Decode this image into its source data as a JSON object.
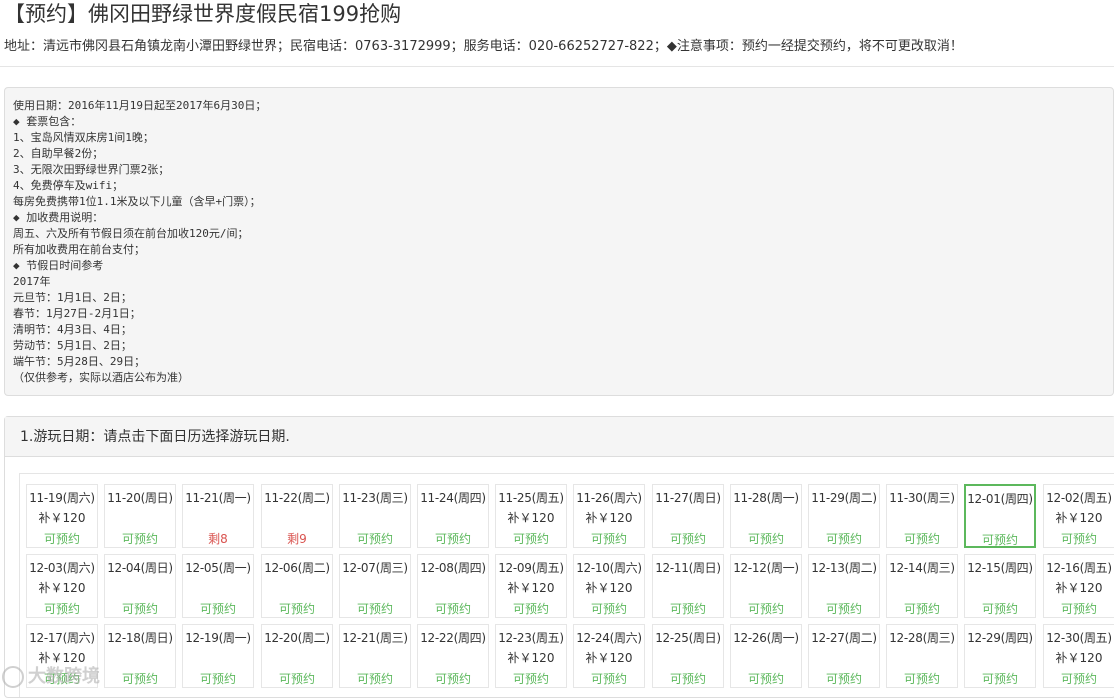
{
  "page": {
    "title": "【预约】佛冈田野绿世界度假民宿199抢购",
    "address_line": "地址：清远市佛冈县石角镇龙南小潭田野绿世界；民宿电话：0763-3172999；服务电话：020-66252727-822；◆注意事项：预约一经提交预约，将不可更改取消！"
  },
  "info": {
    "lines": [
      "使用日期：2016年11月19日起至2017年6月30日；",
      "◆ 套票包含：",
      "1、宝岛风情双床房1间1晚；",
      "2、自助早餐2份；",
      "3、无限次田野绿世界门票2张；",
      "4、免费停车及wifi；",
      "每房免费携带1位1.1米及以下儿童（含早+门票）；",
      "◆ 加收费用说明：",
      "周五、六及所有节假日须在前台加收120元/间；",
      "所有加收费用在前台支付；",
      "◆ 节假日时间参考",
      "2017年",
      "元旦节：1月1日、2日；",
      "春节：1月27日-2月1日；",
      "清明节：4月3日、4日；",
      "劳动节：5月1日、2日；",
      "端午节：5月28日、29日；",
      "（仅供参考，实际以酒店公布为准）"
    ]
  },
  "booking": {
    "step_title": "1.游玩日期：请点击下面日历选择游玩日期.",
    "selected_color": "#5cb85c",
    "status_color": "#5cb85c",
    "remaining_color": "#d9534f",
    "days": [
      {
        "date": "11-19(周六)",
        "price": "补￥120",
        "status": "可预约",
        "kind": "ok"
      },
      {
        "date": "11-20(周日)",
        "price": "",
        "status": "可预约",
        "kind": "ok"
      },
      {
        "date": "11-21(周一)",
        "price": "",
        "status": "剩8",
        "kind": "left"
      },
      {
        "date": "11-22(周二)",
        "price": "",
        "status": "剩9",
        "kind": "left"
      },
      {
        "date": "11-23(周三)",
        "price": "",
        "status": "可预约",
        "kind": "ok"
      },
      {
        "date": "11-24(周四)",
        "price": "",
        "status": "可预约",
        "kind": "ok"
      },
      {
        "date": "11-25(周五)",
        "price": "补￥120",
        "status": "可预约",
        "kind": "ok"
      },
      {
        "date": "11-26(周六)",
        "price": "补￥120",
        "status": "可预约",
        "kind": "ok"
      },
      {
        "date": "11-27(周日)",
        "price": "",
        "status": "可预约",
        "kind": "ok"
      },
      {
        "date": "11-28(周一)",
        "price": "",
        "status": "可预约",
        "kind": "ok"
      },
      {
        "date": "11-29(周二)",
        "price": "",
        "status": "可预约",
        "kind": "ok"
      },
      {
        "date": "11-30(周三)",
        "price": "",
        "status": "可预约",
        "kind": "ok"
      },
      {
        "date": "12-01(周四)",
        "price": "",
        "status": "可预约",
        "kind": "ok",
        "selected": true
      },
      {
        "date": "12-02(周五)",
        "price": "补￥120",
        "status": "可预约",
        "kind": "ok"
      },
      {
        "date": "12-03(周六)",
        "price": "补￥120",
        "status": "可预约",
        "kind": "ok"
      },
      {
        "date": "12-04(周日)",
        "price": "",
        "status": "可预约",
        "kind": "ok"
      },
      {
        "date": "12-05(周一)",
        "price": "",
        "status": "可预约",
        "kind": "ok"
      },
      {
        "date": "12-06(周二)",
        "price": "",
        "status": "可预约",
        "kind": "ok"
      },
      {
        "date": "12-07(周三)",
        "price": "",
        "status": "可预约",
        "kind": "ok"
      },
      {
        "date": "12-08(周四)",
        "price": "",
        "status": "可预约",
        "kind": "ok"
      },
      {
        "date": "12-09(周五)",
        "price": "补￥120",
        "status": "可预约",
        "kind": "ok"
      },
      {
        "date": "12-10(周六)",
        "price": "补￥120",
        "status": "可预约",
        "kind": "ok"
      },
      {
        "date": "12-11(周日)",
        "price": "",
        "status": "可预约",
        "kind": "ok"
      },
      {
        "date": "12-12(周一)",
        "price": "",
        "status": "可预约",
        "kind": "ok"
      },
      {
        "date": "12-13(周二)",
        "price": "",
        "status": "可预约",
        "kind": "ok"
      },
      {
        "date": "12-14(周三)",
        "price": "",
        "status": "可预约",
        "kind": "ok"
      },
      {
        "date": "12-15(周四)",
        "price": "",
        "status": "可预约",
        "kind": "ok"
      },
      {
        "date": "12-16(周五)",
        "price": "补￥120",
        "status": "可预约",
        "kind": "ok"
      },
      {
        "date": "12-17(周六)",
        "price": "补￥120",
        "status": "可预约",
        "kind": "ok"
      },
      {
        "date": "12-18(周日)",
        "price": "",
        "status": "可预约",
        "kind": "ok"
      },
      {
        "date": "12-19(周一)",
        "price": "",
        "status": "可预约",
        "kind": "ok"
      },
      {
        "date": "12-20(周二)",
        "price": "",
        "status": "可预约",
        "kind": "ok"
      },
      {
        "date": "12-21(周三)",
        "price": "",
        "status": "可预约",
        "kind": "ok"
      },
      {
        "date": "12-22(周四)",
        "price": "",
        "status": "可预约",
        "kind": "ok"
      },
      {
        "date": "12-23(周五)",
        "price": "补￥120",
        "status": "可预约",
        "kind": "ok"
      },
      {
        "date": "12-24(周六)",
        "price": "补￥120",
        "status": "可预约",
        "kind": "ok"
      },
      {
        "date": "12-25(周日)",
        "price": "",
        "status": "可预约",
        "kind": "ok"
      },
      {
        "date": "12-26(周一)",
        "price": "",
        "status": "可预约",
        "kind": "ok"
      },
      {
        "date": "12-27(周二)",
        "price": "",
        "status": "可预约",
        "kind": "ok"
      },
      {
        "date": "12-28(周三)",
        "price": "",
        "status": "可预约",
        "kind": "ok"
      },
      {
        "date": "12-29(周四)",
        "price": "",
        "status": "可预约",
        "kind": "ok"
      },
      {
        "date": "12-30(周五)",
        "price": "补￥120",
        "status": "可预约",
        "kind": "ok"
      }
    ]
  },
  "watermark": {
    "text": "大数跨境",
    "icon": "brand-logo-icon"
  }
}
